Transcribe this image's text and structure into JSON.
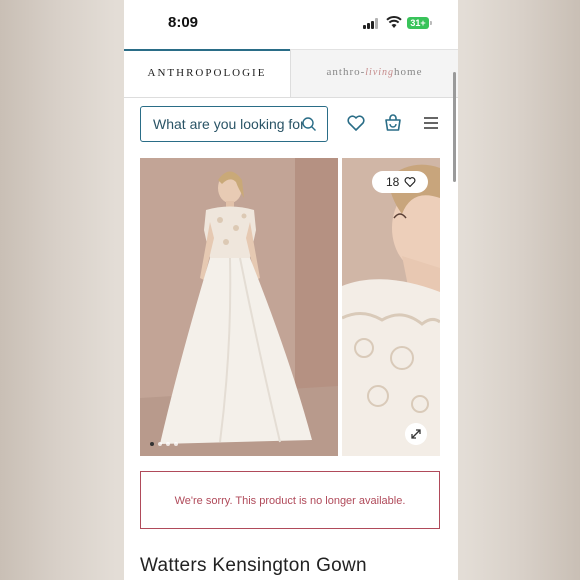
{
  "status_bar": {
    "time": "8:09",
    "battery": "31+"
  },
  "brand_tabs": {
    "anthropologie": "ANTHROPOLOGIE",
    "living_prefix": "anthro-",
    "living_mid": "living",
    "living_suffix": "home"
  },
  "search": {
    "placeholder": "What are you looking for?"
  },
  "icons": [
    "search-icon",
    "heart-icon",
    "bag-icon",
    "menu-icon",
    "heart-icon",
    "expand-icon"
  ],
  "gallery": {
    "favorites_count": "18",
    "pages": 4,
    "current_page": 1
  },
  "notice": {
    "text": "We're sorry. This product is no longer available."
  },
  "product": {
    "title": "Watters Kensington Gown"
  },
  "colors": {
    "accent": "#2a6d87",
    "error": "#b04a5a"
  }
}
